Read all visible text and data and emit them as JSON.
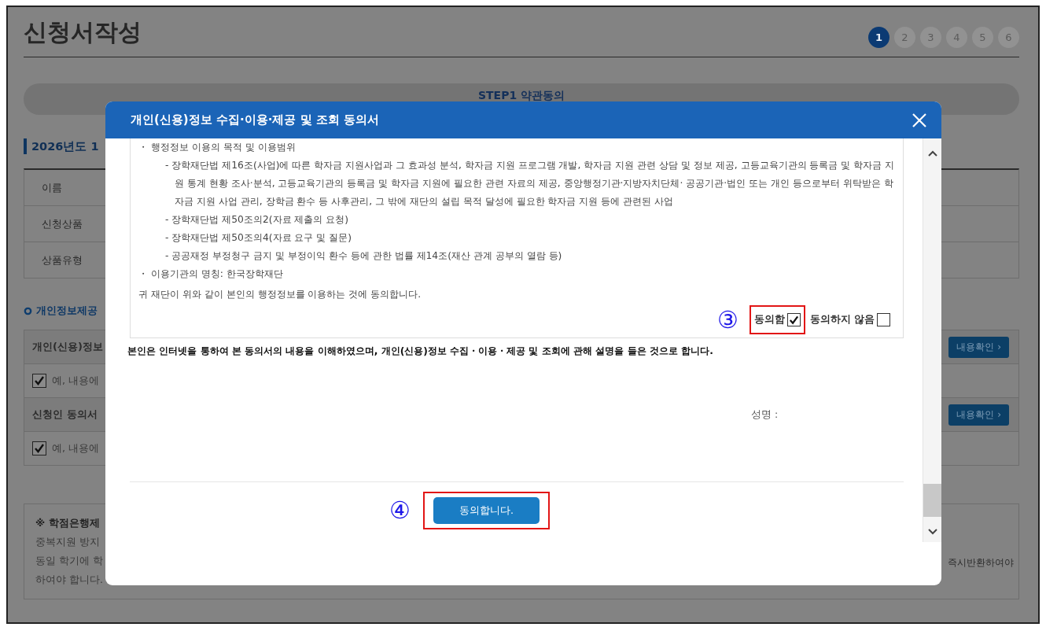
{
  "page": {
    "title": "신청서작성",
    "steps": [
      {
        "label": "1",
        "selected": true
      },
      {
        "label": "2",
        "selected": false
      },
      {
        "label": "3",
        "selected": false
      },
      {
        "label": "4",
        "selected": false
      },
      {
        "label": "5",
        "selected": false
      },
      {
        "label": "6",
        "selected": false
      }
    ],
    "step_bar": "STEP1 약관동의",
    "section_title": "2026년도 1",
    "info_rows": [
      {
        "label": "이름"
      },
      {
        "label": "신청상품"
      },
      {
        "label": "상품유형"
      }
    ],
    "consent_heading": "개인정보제공",
    "consent_items": [
      {
        "title": "개인(신용)정보",
        "button": "내용확인",
        "chevron": "›",
        "checkbox_label": "예, 내용에",
        "checked": true
      },
      {
        "title": "신청인 동의서",
        "button": "내용확인",
        "chevron": "›",
        "checkbox_label": "예, 내용에",
        "checked": true
      }
    ],
    "notice": {
      "title": "※ 학점은행제",
      "lines": [
        "중복지원 방지",
        "동일 학기에 학",
        "하여야 합니다."
      ],
      "right_fragment": "즉시반환하여야"
    }
  },
  "modal": {
    "title": "개인(신용)정보 수집·이용·제공 및 조회 동의서",
    "items": [
      {
        "kind": "bullet",
        "marker": "・",
        "text": "행정정보 이용의 목적 및 이용범위"
      },
      {
        "kind": "dash",
        "marker": "-",
        "text": "장학재단법 제16조(사업)에 따른 학자금 지원사업과 그 효과성 분석, 학자금 지원 프로그램 개발, 학자금 지원 관련 상담 및 정보 제공, 고등교육기관의 등록금 및 학자금 지원 통계 현황 조사·분석, 고등교육기관의 등록금 및 학자금 지원에 필요한 관련 자료의 제공, 중앙행정기관·지방자치단체· 공공기관·법인 또는 개인 등으로부터 위탁받은 학자금 지원 사업 관리, 장학금 환수 등 사후관리, 그 밖에 재단의 설립 목적 달성에 필요한 학자금 지원 등에 관련된 사업"
      },
      {
        "kind": "dash",
        "marker": "-",
        "text": "장학재단법 제50조의2(자료 제출의 요청)"
      },
      {
        "kind": "dash",
        "marker": "-",
        "text": "장학재단법 제50조의4(자료 요구 및 질문)"
      },
      {
        "kind": "dash",
        "marker": "-",
        "text": "공공재정 부정청구 금지 및 부정이익 환수 등에 관한 법률 제14조(재산 관계 공부의 열람 등)"
      },
      {
        "kind": "bullet",
        "marker": "・",
        "text": "이용기관의 명칭: 한국장학재단"
      }
    ],
    "statement": "귀 재단이 위와 같이 본인의 행정정보를 이용하는 것에 동의합니다.",
    "agree_marker": "③",
    "agree_options": [
      {
        "label": "동의함",
        "checked": true
      },
      {
        "label": "동의하지 않음",
        "checked": false
      }
    ],
    "declaration": "본인은 인터넷을 통하여 본 동의서의 내용을 이해하였으며, 개인(신용)정보 수집・이용・제공 및 조회에 관해 설명을 들은 것으로 합니다.",
    "signature_label": "성명 :",
    "button_marker": "④",
    "confirm_button": "동의합니다."
  }
}
